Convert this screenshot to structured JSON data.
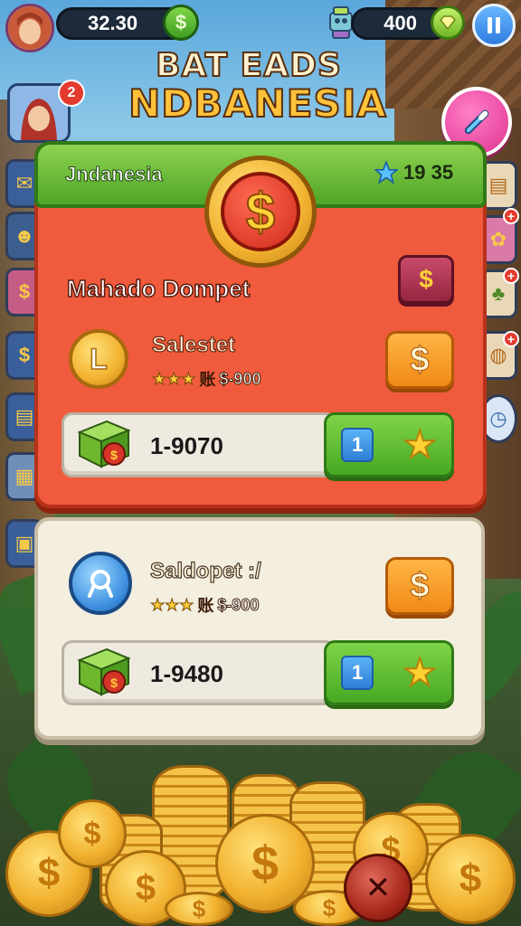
{
  "hud": {
    "coins_value": "32.30",
    "gems_value": "400",
    "dollar_symbol": "$",
    "notification_count": "2",
    "pause_icon": "pause-icon"
  },
  "title": {
    "line1": "BAT EADS",
    "line2": "NDBANESIA"
  },
  "panel1": {
    "header_title": "Jndanesia",
    "header_score": "19 35",
    "badge_symbol": "$",
    "section_label": "Mahado Dompet",
    "small_button_symbol": "$",
    "item_name": "Salestet",
    "item_rating_stars": "★★★",
    "item_price": "$-900",
    "item_price_prefix": "账",
    "item_icon_letter": "L",
    "buy_button_symbol": "$",
    "progress_value": "1-9070",
    "action_number": "1"
  },
  "panel2": {
    "item_name": "Saldopet :/",
    "item_rating_stars": "★★★",
    "item_price": "$-900",
    "item_price_prefix": "账",
    "buy_button_symbol": "$",
    "progress_value": "1-9480",
    "action_number": "1"
  },
  "colors": {
    "panel_red": "#ef5b3c",
    "panel_header_green": "#6cbf3c",
    "panel_cream": "#f3eede",
    "accent_orange": "#f39a1e",
    "accent_green": "#5fbd2f"
  }
}
